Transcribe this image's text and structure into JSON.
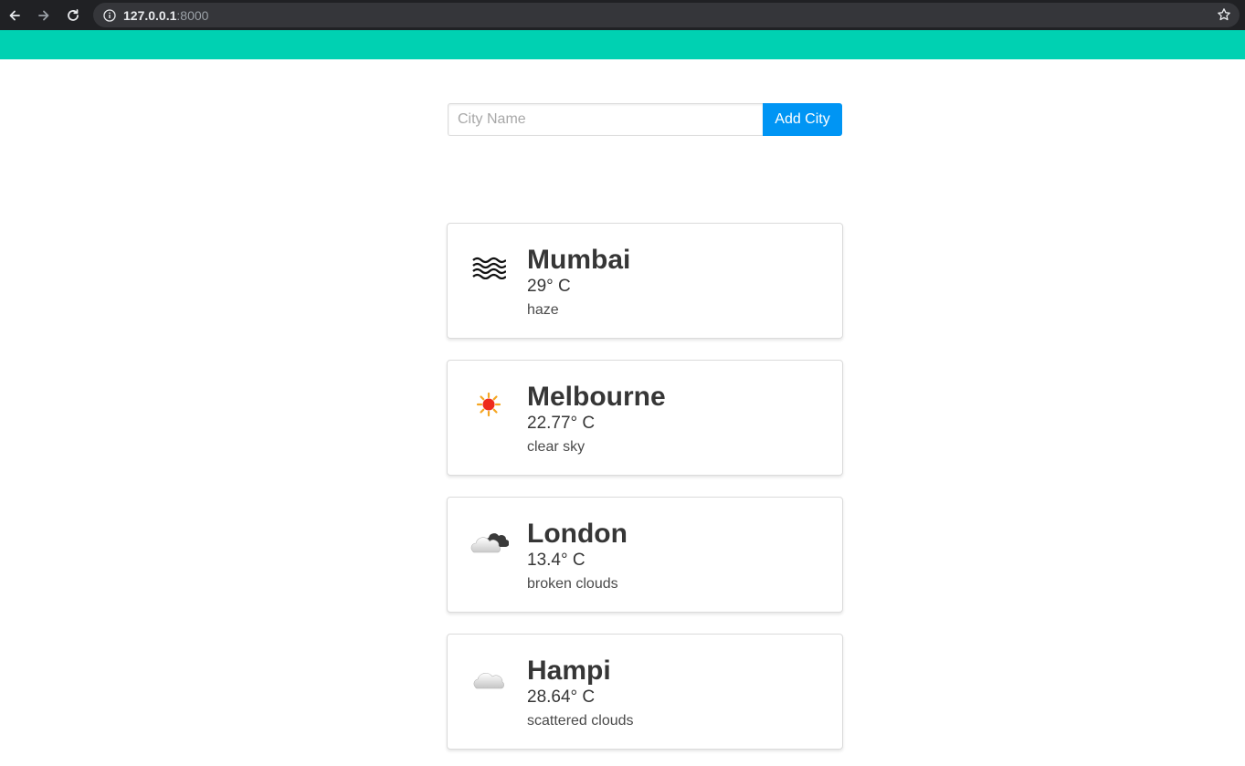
{
  "browser": {
    "url_host": "127.0.0.1",
    "url_port": ":8000"
  },
  "form": {
    "placeholder": "City Name",
    "value": "",
    "button_label": "Add City"
  },
  "colors": {
    "hero": "#00d1b2",
    "button": "#0095f4"
  },
  "cities": [
    {
      "name": "Mumbai",
      "temp": "29° C",
      "description": "haze",
      "icon": "haze-icon"
    },
    {
      "name": "Melbourne",
      "temp": "22.77° C",
      "description": "clear sky",
      "icon": "sun-icon"
    },
    {
      "name": "London",
      "temp": "13.4° C",
      "description": "broken clouds",
      "icon": "broken-clouds-icon"
    },
    {
      "name": "Hampi",
      "temp": "28.64° C",
      "description": "scattered clouds",
      "icon": "cloud-icon"
    }
  ]
}
